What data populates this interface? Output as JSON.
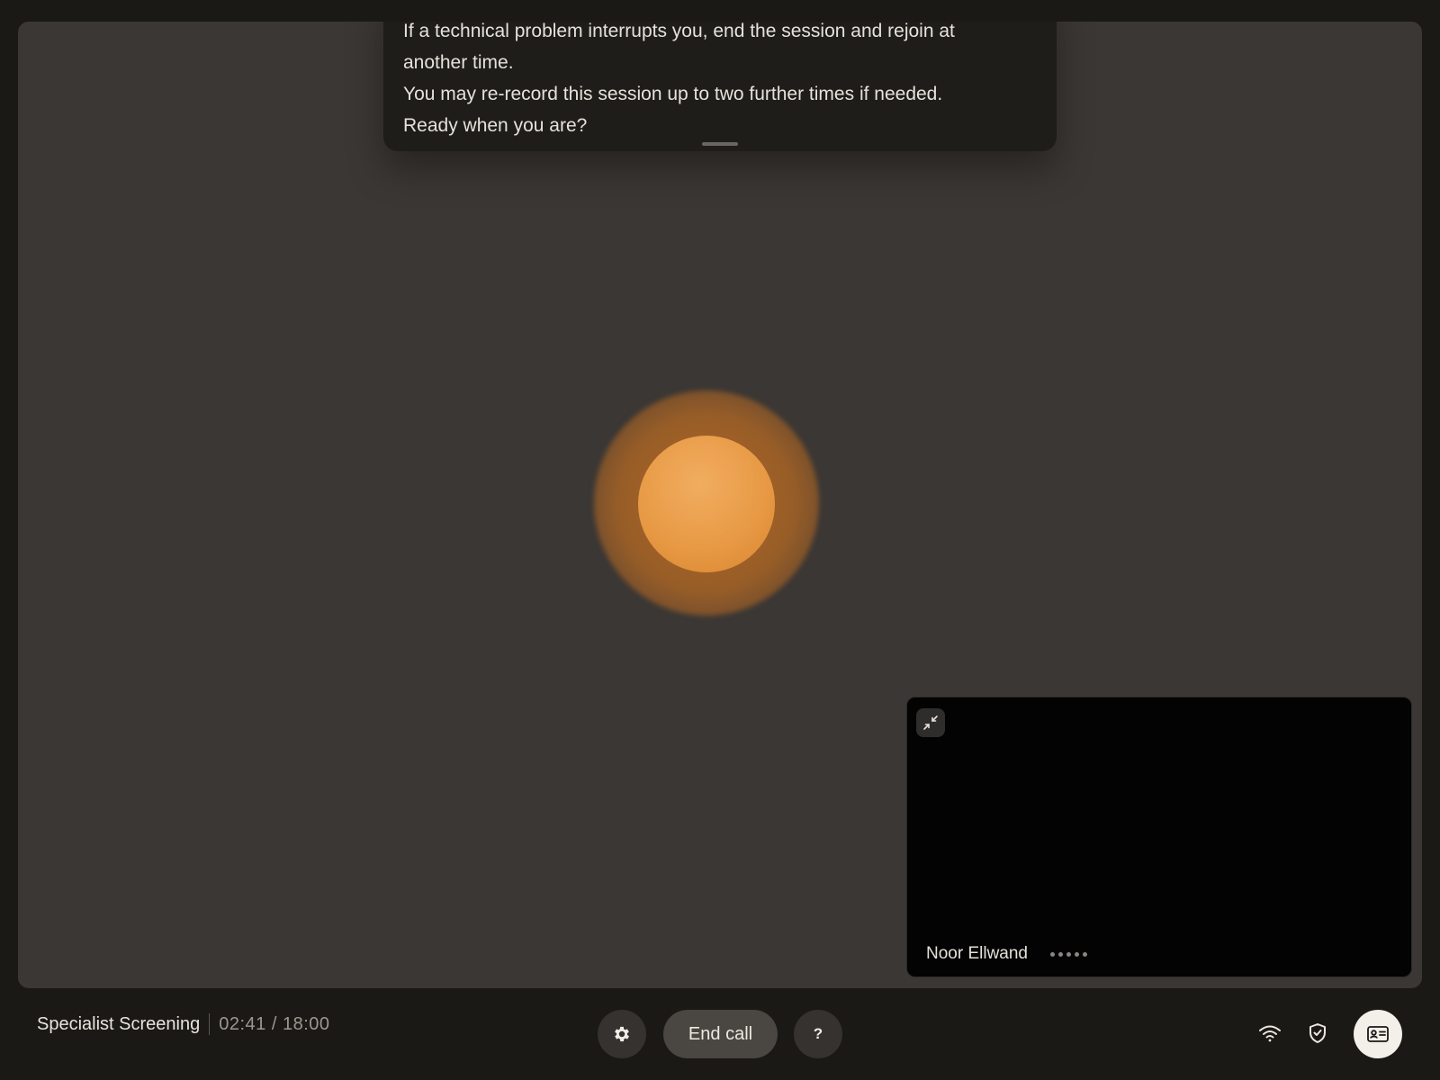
{
  "transcript": {
    "lines": [
      "If a technical problem interrupts you, end the session and rejoin at",
      "another time.",
      "You may re-record this session up to two further times if needed.",
      "Ready when you are?"
    ]
  },
  "orb": {
    "core_color": "#e89a45",
    "halo_color": "#a8642a"
  },
  "self_view": {
    "participant_name": "Noor Ellwand",
    "collapse_icon": "collapse-arrows-icon"
  },
  "session": {
    "title": "Specialist Screening",
    "elapsed": "02:41",
    "separator": "/",
    "total": "18:00"
  },
  "controls": {
    "settings_icon": "gear-icon",
    "end_call_label": "End call",
    "help_label": "?"
  },
  "status": {
    "wifi_icon": "wifi-icon",
    "shield_icon": "shield-check-icon",
    "id_icon": "id-card-icon"
  }
}
